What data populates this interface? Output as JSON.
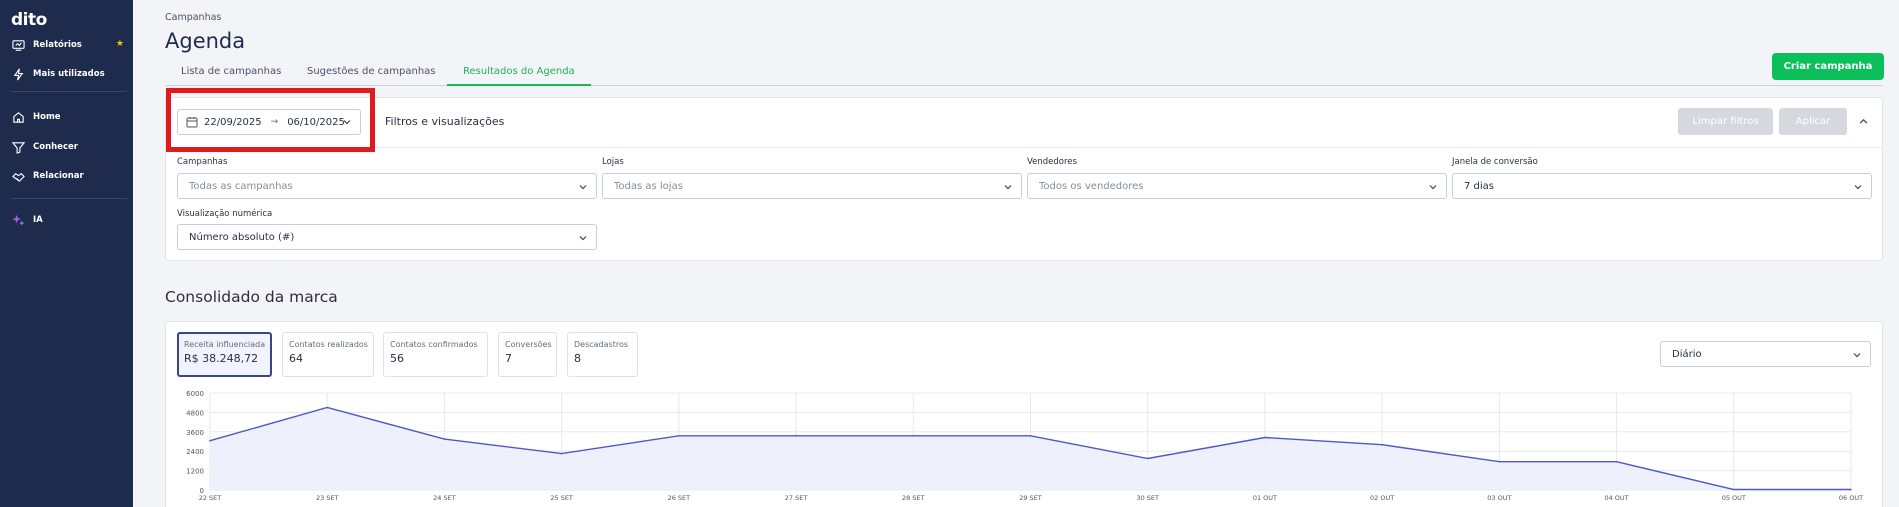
{
  "app": {
    "logo": "dito"
  },
  "sidebar": {
    "items": [
      {
        "label": "Relatórios",
        "icon": "reports-icon",
        "starred": true
      },
      {
        "label": "Mais utilizados",
        "icon": "lightning-icon"
      },
      {
        "label": "Home",
        "icon": "home-icon"
      },
      {
        "label": "Conhecer",
        "icon": "filter-icon"
      },
      {
        "label": "Relacionar",
        "icon": "handshake-icon"
      },
      {
        "label": "IA",
        "icon": "sparkles-icon"
      }
    ]
  },
  "header": {
    "breadcrumb": "Campanhas",
    "title": "Agenda",
    "tabs": [
      {
        "label": "Lista de campanhas",
        "active": false
      },
      {
        "label": "Sugestões de campanhas",
        "active": false
      },
      {
        "label": "Resultados do Agenda",
        "active": true
      }
    ],
    "create_button": "Criar campanha"
  },
  "filters": {
    "date_start": "22/09/2025",
    "date_separator": "→",
    "date_end": "06/10/2025",
    "title": "Filtros e visualizações",
    "clear_button": "Limpar filtros",
    "apply_button": "Aplicar",
    "fields": [
      {
        "label": "Campanhas",
        "value": "Todas as campanhas",
        "placeholder": true
      },
      {
        "label": "Lojas",
        "value": "Todas as lojas",
        "placeholder": true
      },
      {
        "label": "Vendedores",
        "value": "Todos os vendedores",
        "placeholder": true
      },
      {
        "label": "Janela de conversão",
        "value": "7 dias",
        "placeholder": false
      },
      {
        "label": "Visualização numérica",
        "value": "Número absoluto (#)",
        "placeholder": false
      }
    ]
  },
  "consolidado": {
    "title": "Consolidado da marca",
    "kpis": [
      {
        "label": "Receita influenciada",
        "value": "R$ 38.248,72",
        "selected": true
      },
      {
        "label": "Contatos realizados",
        "value": "64",
        "selected": false
      },
      {
        "label": "Contatos confirmados",
        "value": "56",
        "selected": false
      },
      {
        "label": "Conversões",
        "value": "7",
        "selected": false
      },
      {
        "label": "Descadastros",
        "value": "8",
        "selected": false
      }
    ],
    "granularity": "Diário"
  },
  "colors": {
    "sidebar_bg": "#1f2b4d",
    "accent_green": "#0bbf5b",
    "highlight_red": "#e11b1b",
    "line": "#4f58c9",
    "area_fill": "#eceefb"
  },
  "chart_data": {
    "type": "area",
    "x": [
      "22 SET",
      "23 SET",
      "24 SET",
      "25 SET",
      "26 SET",
      "27 SET",
      "28 SET",
      "29 SET",
      "30 SET",
      "01 OUT",
      "02 OUT",
      "03 OUT",
      "04 OUT",
      "05 OUT",
      "06 OUT"
    ],
    "series": [
      {
        "values": [
          3050,
          5100,
          3150,
          2250,
          3350,
          3350,
          3350,
          3350,
          1950,
          3250,
          2800,
          1750,
          1750,
          30,
          30
        ]
      }
    ],
    "yticks": [
      0,
      1200,
      2400,
      3600,
      4800,
      6000
    ],
    "ylim": [
      0,
      6000
    ],
    "grid": true
  }
}
